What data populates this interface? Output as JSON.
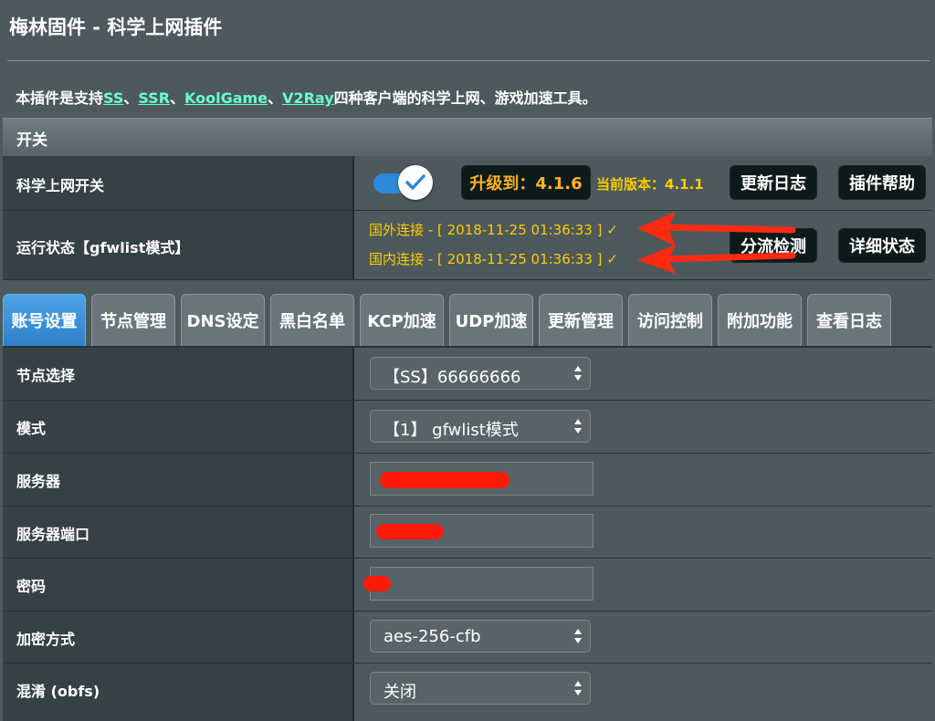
{
  "header": {
    "title": "梅林固件 - 科学上网插件",
    "desc_prefix": "本插件是支持",
    "links": [
      "SS",
      "SSR",
      "KoolGame",
      "V2Ray"
    ],
    "sep": "、",
    "desc_suffix": "四种客户端的科学上网、游戏加速工具。"
  },
  "section": {
    "title": "开关"
  },
  "switch_row": {
    "label": "科学上网开关",
    "toggle_on": true,
    "upgrade_button": "升级到：4.1.6",
    "current_version": "当前版本：4.1.1",
    "changelog_button": "更新日志",
    "help_button": "插件帮助"
  },
  "status_row": {
    "label": "运行状态【gfwlist模式】",
    "foreign": "国外连接 - [ 2018-11-25 01:36:33 ] ✓",
    "domestic": "国内连接 - [ 2018-11-25 01:36:33 ] ✓",
    "split_check_button": "分流检测",
    "detail_button": "详细状态"
  },
  "tabs": [
    {
      "label": "账号设置",
      "active": true
    },
    {
      "label": "节点管理"
    },
    {
      "label": "DNS设定"
    },
    {
      "label": "黑白名单"
    },
    {
      "label": "KCP加速"
    },
    {
      "label": "UDP加速"
    },
    {
      "label": "更新管理"
    },
    {
      "label": "访问控制"
    },
    {
      "label": "附加功能"
    },
    {
      "label": "查看日志"
    }
  ],
  "form": {
    "node_label": "节点选择",
    "node_value": "【SS】66666666",
    "mode_label": "模式",
    "mode_value": "【1】 gfwlist模式",
    "server_label": "服务器",
    "port_label": "服务器端口",
    "password_label": "密码",
    "cipher_label": "加密方式",
    "cipher_value": "aes-256-cfb",
    "obfs_label": "混淆 (obfs)",
    "obfs_value": "关闭"
  },
  "colors": {
    "background": "#4d595d",
    "label_column": "#364145",
    "link": "#69ffcc",
    "status_text": "#ffcc00",
    "active_tab": "#3b8fd6",
    "toggle": "#2c8ad8",
    "annotation_arrow": "#ff2a12"
  }
}
